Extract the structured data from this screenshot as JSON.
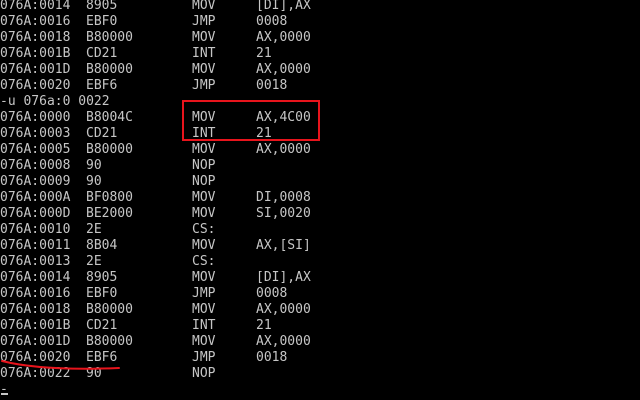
{
  "colors": {
    "background": "#000000",
    "text": "#c6c6c6",
    "annotation": "#e8141c"
  },
  "lines": [
    {
      "addr": "076A:0014",
      "hex": "8905",
      "mn": "MOV",
      "op": "[DI],AX"
    },
    {
      "addr": "076A:0016",
      "hex": "EBF0",
      "mn": "JMP",
      "op": "0008"
    },
    {
      "addr": "076A:0018",
      "hex": "B80000",
      "mn": "MOV",
      "op": "AX,0000"
    },
    {
      "addr": "076A:001B",
      "hex": "CD21",
      "mn": "INT",
      "op": "21"
    },
    {
      "addr": "076A:001D",
      "hex": "B80000",
      "mn": "MOV",
      "op": "AX,0000"
    },
    {
      "addr": "076A:0020",
      "hex": "EBF6",
      "mn": "JMP",
      "op": "0018"
    },
    {
      "cmd": "-u 076a:0 0022"
    },
    {
      "addr": "076A:0000",
      "hex": "B8004C",
      "mn": "MOV",
      "op": "AX,4C00"
    },
    {
      "addr": "076A:0003",
      "hex": "CD21",
      "mn": "INT",
      "op": "21"
    },
    {
      "addr": "076A:0005",
      "hex": "B80000",
      "mn": "MOV",
      "op": "AX,0000"
    },
    {
      "addr": "076A:0008",
      "hex": "90",
      "mn": "NOP",
      "op": ""
    },
    {
      "addr": "076A:0009",
      "hex": "90",
      "mn": "NOP",
      "op": ""
    },
    {
      "addr": "076A:000A",
      "hex": "BF0800",
      "mn": "MOV",
      "op": "DI,0008"
    },
    {
      "addr": "076A:000D",
      "hex": "BE2000",
      "mn": "MOV",
      "op": "SI,0020"
    },
    {
      "addr": "076A:0010",
      "hex": "2E",
      "mn": "CS:",
      "op": ""
    },
    {
      "addr": "076A:0011",
      "hex": "8B04",
      "mn": "MOV",
      "op": "AX,[SI]"
    },
    {
      "addr": "076A:0013",
      "hex": "2E",
      "mn": "CS:",
      "op": ""
    },
    {
      "addr": "076A:0014",
      "hex": "8905",
      "mn": "MOV",
      "op": "[DI],AX"
    },
    {
      "addr": "076A:0016",
      "hex": "EBF0",
      "mn": "JMP",
      "op": "0008"
    },
    {
      "addr": "076A:0018",
      "hex": "B80000",
      "mn": "MOV",
      "op": "AX,0000"
    },
    {
      "addr": "076A:001B",
      "hex": "CD21",
      "mn": "INT",
      "op": "21"
    },
    {
      "addr": "076A:001D",
      "hex": "B80000",
      "mn": "MOV",
      "op": "AX,0000"
    },
    {
      "addr": "076A:0020",
      "hex": "EBF6",
      "mn": "JMP",
      "op": "0018"
    },
    {
      "addr": "076A:0022",
      "hex": "90",
      "mn": "NOP",
      "op": ""
    },
    {
      "cmd": "-"
    }
  ]
}
